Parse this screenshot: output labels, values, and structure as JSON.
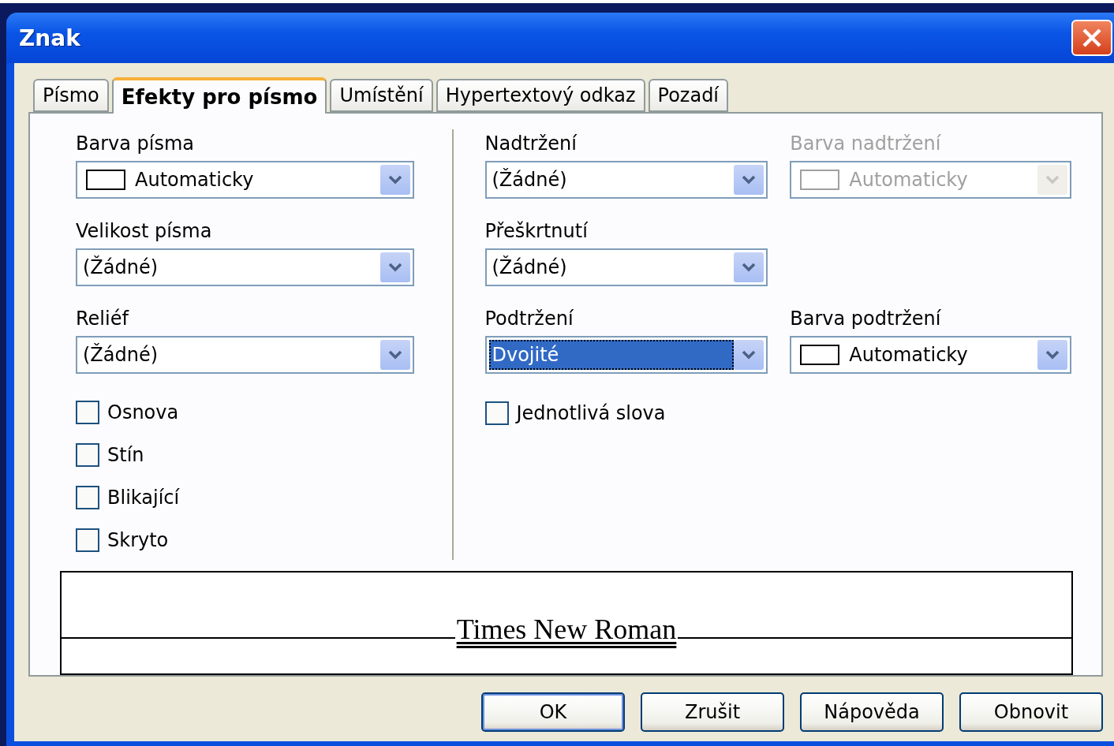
{
  "window": {
    "title": "Znak"
  },
  "tabs": [
    {
      "label": "Písmo",
      "selected": false
    },
    {
      "label": "Efekty pro písmo",
      "selected": true
    },
    {
      "label": "Umístění",
      "selected": false
    },
    {
      "label": "Hypertextový odkaz",
      "selected": false
    },
    {
      "label": "Pozadí",
      "selected": false
    }
  ],
  "left_column": {
    "fields": [
      {
        "label": "Barva písma",
        "value": "Automaticky",
        "swatch": true,
        "disabled": false,
        "highlighted": false
      },
      {
        "label": "Velikost písma",
        "value": "(Žádné)",
        "swatch": false,
        "disabled": false,
        "highlighted": false
      },
      {
        "label": "Reliéf",
        "value": "(Žádné)",
        "swatch": false,
        "disabled": false,
        "highlighted": false
      }
    ],
    "checkboxes": [
      {
        "label": "Osnova",
        "checked": false
      },
      {
        "label": "Stín",
        "checked": false
      },
      {
        "label": "Blikající",
        "checked": false
      },
      {
        "label": "Skryto",
        "checked": false
      }
    ]
  },
  "middle_column": {
    "fields": [
      {
        "label": "Nadtržení",
        "value": "(Žádné)",
        "swatch": false,
        "disabled": false,
        "highlighted": false
      },
      {
        "label": "Přeškrtnutí",
        "value": "(Žádné)",
        "swatch": false,
        "disabled": false,
        "highlighted": false
      },
      {
        "label": "Podtržení",
        "value": "Dvojité",
        "swatch": false,
        "disabled": false,
        "highlighted": true
      }
    ],
    "checkboxes": [
      {
        "label": "Jednotlivá slova",
        "checked": false
      }
    ]
  },
  "right_column": {
    "fields": [
      {
        "label": "Barva nadtržení",
        "value": "Automaticky",
        "swatch": true,
        "disabled": true,
        "highlighted": false
      },
      {
        "label": "Barva podtržení",
        "value": "Automaticky",
        "swatch": true,
        "disabled": false,
        "highlighted": false
      }
    ]
  },
  "preview": {
    "text": "Times New Roman"
  },
  "buttons": [
    {
      "label": "OK",
      "default": true
    },
    {
      "label": "Zrušit",
      "default": false
    },
    {
      "label": "Nápověda",
      "default": false
    },
    {
      "label": "Obnovit",
      "default": false
    }
  ]
}
